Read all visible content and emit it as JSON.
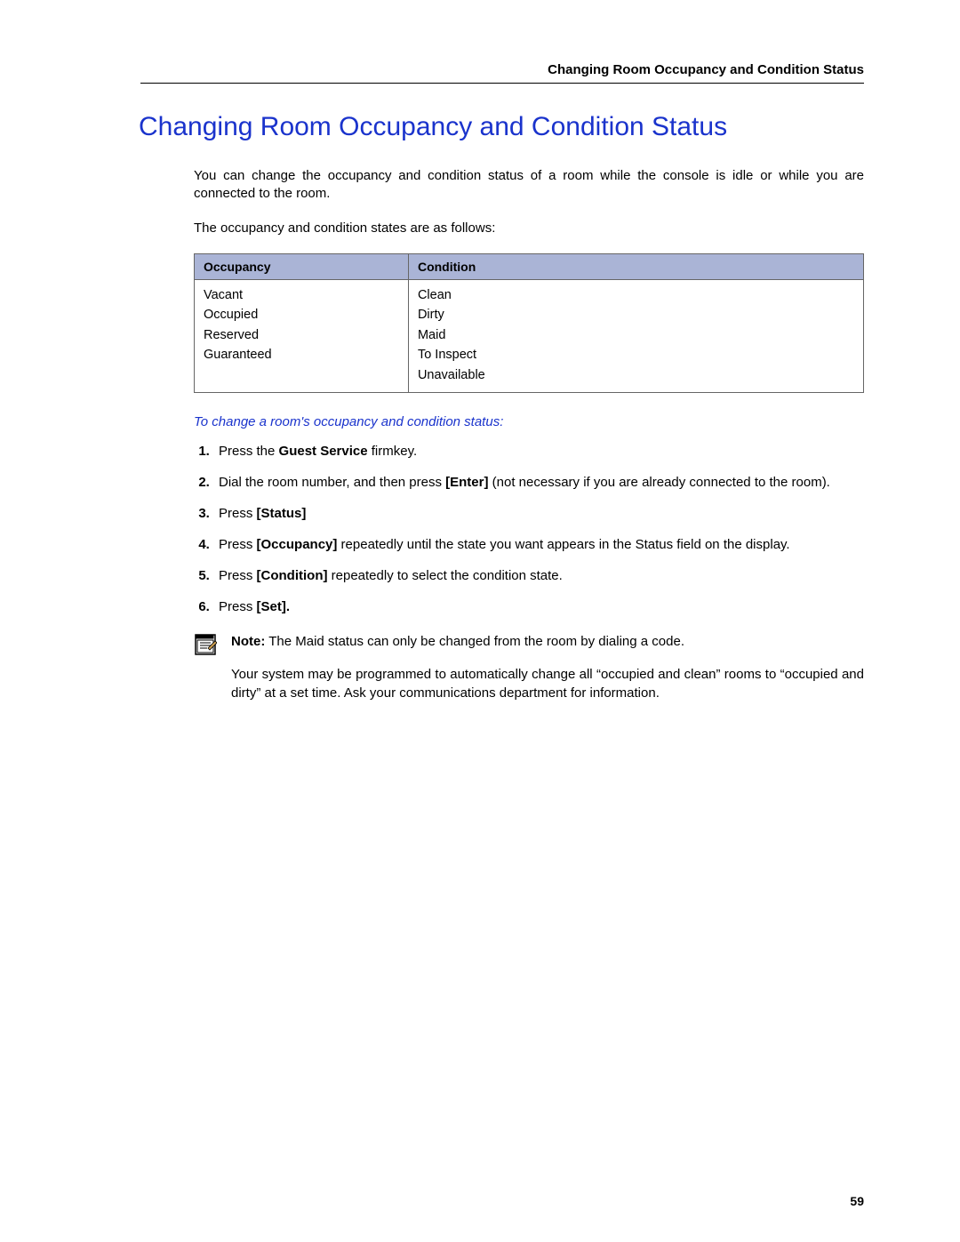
{
  "running_head": "Changing Room Occupancy and Condition Status",
  "title": "Changing Room Occupancy and Condition Status",
  "intro_1": "You can change the occupancy and condition status of a room while the console is idle or while you are connected to the room.",
  "intro_2": "The occupancy and condition states are as follows:",
  "table": {
    "headers": {
      "col1": "Occupancy",
      "col2": "Condition"
    },
    "col1_rows": [
      "Vacant",
      "Occupied",
      "Reserved",
      "Guaranteed"
    ],
    "col2_rows": [
      "Clean",
      "Dirty",
      "Maid",
      "To Inspect",
      "Unavailable"
    ]
  },
  "subheading": "To change a room's occupancy and condition status:",
  "steps": {
    "s1_a": "Press the ",
    "s1_b": "Guest Service",
    "s1_c": " firmkey.",
    "s2_a": "Dial the room number, and then press ",
    "s2_b": "[Enter]",
    "s2_c": "  (not necessary if you are already connected to the room).",
    "s3_a": "Press ",
    "s3_b": "[Status]",
    "s4_a": "Press ",
    "s4_b": "[Occupancy]",
    "s4_c": " repeatedly until the state you want appears in the Status field on the display.",
    "s5_a": "Press ",
    "s5_b": "[Condition]",
    "s5_c": " repeatedly to select the condition state.",
    "s6_a": "Press ",
    "s6_b": "[Set]."
  },
  "note": {
    "label": "Note:",
    "line1": " The Maid status can only be changed from the room by dialing a code.",
    "line2": "Your system may be programmed to automatically change all “occupied and clean” rooms to “occupied and dirty” at a set time. Ask your communications department for information."
  },
  "page_number": "59"
}
